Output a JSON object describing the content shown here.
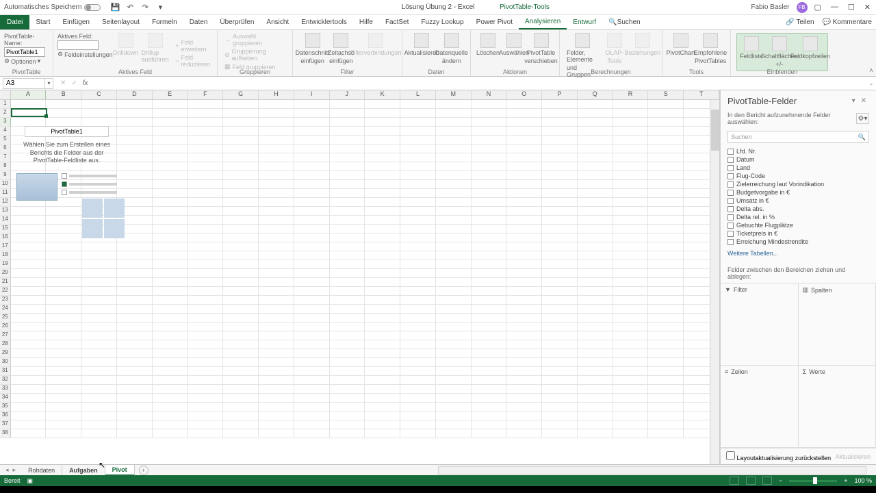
{
  "title": {
    "autosave": "Automatisches Speichern",
    "doc": "Lösung Übung 2 - Excel",
    "context_tool": "PivotTable-Tools",
    "user": "Fabio Basler",
    "user_initials": "FB"
  },
  "tabs": {
    "file": "Datei",
    "items": [
      "Start",
      "Einfügen",
      "Seitenlayout",
      "Formeln",
      "Daten",
      "Überprüfen",
      "Ansicht",
      "Entwicklertools",
      "Hilfe",
      "FactSet",
      "Fuzzy Lookup",
      "Power Pivot"
    ],
    "context": [
      "Analysieren",
      "Entwurf"
    ],
    "search": "Suchen",
    "share": "Teilen",
    "comments": "Kommentare"
  },
  "ribbon": {
    "pivot_name_label": "PivotTable-Name:",
    "pivot_name_value": "PivotTable1",
    "options": "Optionen",
    "group_pivot": "PivotTable",
    "active_field_label": "Aktives Feld:",
    "drilldown": "Drilldown",
    "drillup_do": "Drillup ausführen",
    "expand": "Feld erweitern",
    "collapse": "Feld reduzieren",
    "settings": "Feldeinstellungen",
    "group_active": "Aktives Feld",
    "sel_group": "Auswahl gruppieren",
    "ungroup": "Gruppierung aufheben",
    "field_group": "Feld gruppieren",
    "group_group": "Gruppieren",
    "slicer1": "Datenschnitt",
    "slicer2": "einfügen",
    "timeline1": "Zeitachse",
    "timeline2": "einfügen",
    "filterconn": "Filterverbindungen",
    "group_filter": "Filter",
    "refresh": "Aktualisieren",
    "src1": "Datenquelle",
    "src2": "ändern",
    "group_data": "Daten",
    "clear": "Löschen",
    "select": "Auswählen",
    "move1": "PivotTable",
    "move2": "verschieben",
    "group_actions": "Aktionen",
    "calc1": "Felder, Elemente",
    "calc2": "und Gruppen",
    "olap": "OLAP-",
    "olap2": "Tools",
    "rel": "Beziehungen",
    "group_calc": "Berechnungen",
    "chart": "PivotChart",
    "rec1": "Empfohlene",
    "rec2": "PivotTables",
    "group_tools": "Tools",
    "fieldlist": "Feldliste",
    "btns": "Schaltflächen",
    "headers1": "Feldkopfzeilen",
    "headers2": "+/-",
    "group_show": "Einblenden"
  },
  "namebox": "A3",
  "columns": [
    "A",
    "B",
    "C",
    "D",
    "E",
    "F",
    "G",
    "H",
    "I",
    "J",
    "K",
    "L",
    "M",
    "N",
    "O",
    "P",
    "Q",
    "R",
    "S",
    "T"
  ],
  "placeholder": {
    "name": "PivotTable1",
    "text1": "Wählen Sie zum Erstellen eines",
    "text2": "Berichts die Felder aus der",
    "text3": "PivotTable-Feldliste aus."
  },
  "pane": {
    "title": "PivotTable-Felder",
    "sub": "In den Bericht aufzunehmende Felder auswählen:",
    "search": "Suchen",
    "fields": [
      "Lfd. Nr.",
      "Datum",
      "Land",
      "Flug-Code",
      "Zielerreichung laut Vorindikation",
      "Budgetvorgabe in €",
      "Umsatz in €",
      "Delta abs.",
      "Delta rel. in %",
      "Gebuchte Flugplätze",
      "Ticketpreis in €",
      "Erreichung Mindestrendite"
    ],
    "more": "Weitere Tabellen...",
    "drag_label": "Felder zwischen den Bereichen ziehen und ablegen:",
    "z_filter": "Filter",
    "z_cols": "Spalten",
    "z_rows": "Zeilen",
    "z_vals": "Werte",
    "defer": "Layoutaktualisierung zurückstellen",
    "update": "Aktualisieren"
  },
  "sheets": {
    "s1": "Rohdaten",
    "s2": "Aufgaben",
    "s3": "Pivot"
  },
  "status": {
    "ready": "Bereit",
    "zoom": "100 %"
  }
}
